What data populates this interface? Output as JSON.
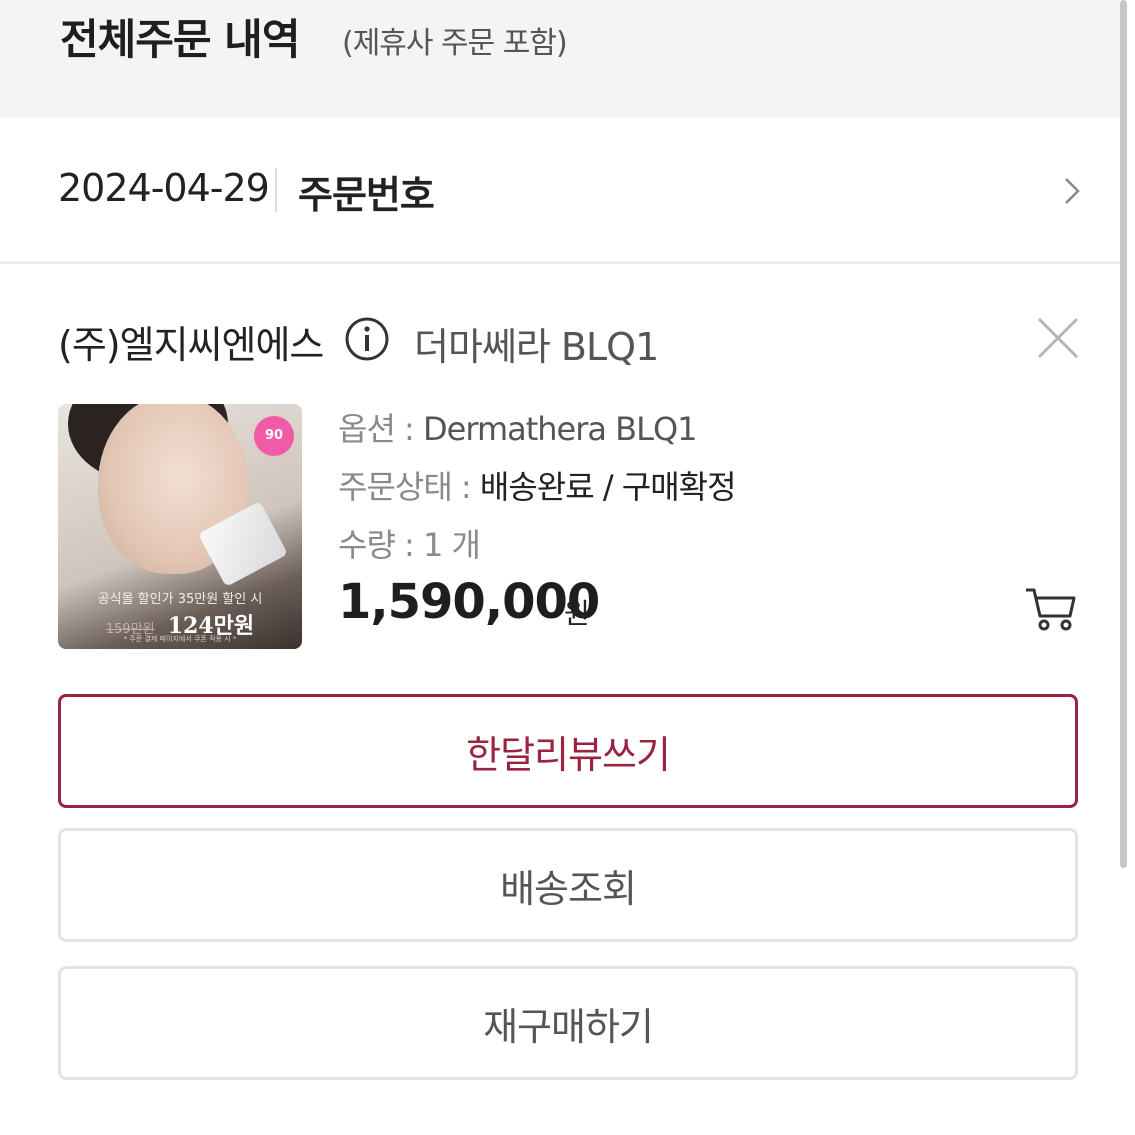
{
  "header": {
    "title": "전체주문 내역",
    "subtitle": "(제휴사 주문 포함)"
  },
  "order": {
    "date": "2024-04-29",
    "order_number_label": "주문번호"
  },
  "seller": {
    "name": "(주)엘지씨엔에스",
    "product_name": "더마쎄라 BLQ1"
  },
  "thumbnail": {
    "badge": "90",
    "caption": "공식몰 할인가 35만원 할인 시",
    "old_price": "159만원",
    "new_price": "124만원",
    "note": "* 주문 결제 페이지에서 쿠폰 적용 시 *"
  },
  "details": {
    "option_label": "옵션 : ",
    "option_value": "Dermathera BLQ1",
    "status_label": "주문상태 : ",
    "status_value": "배송완료 / 구매확정",
    "qty_label": "수량 : ",
    "qty_value": "1 개",
    "price": "1,590,000",
    "price_unit": "원"
  },
  "buttons": {
    "review": "한달리뷰쓰기",
    "track": "배송조회",
    "reorder": "재구매하기"
  },
  "colors": {
    "accent": "#9a2340",
    "header_bg": "#f4f4f4",
    "border": "#e4e4e4"
  },
  "icons": {
    "chevron": "chevron-right-icon",
    "info": "info-icon",
    "close": "close-icon",
    "cart": "cart-icon"
  }
}
